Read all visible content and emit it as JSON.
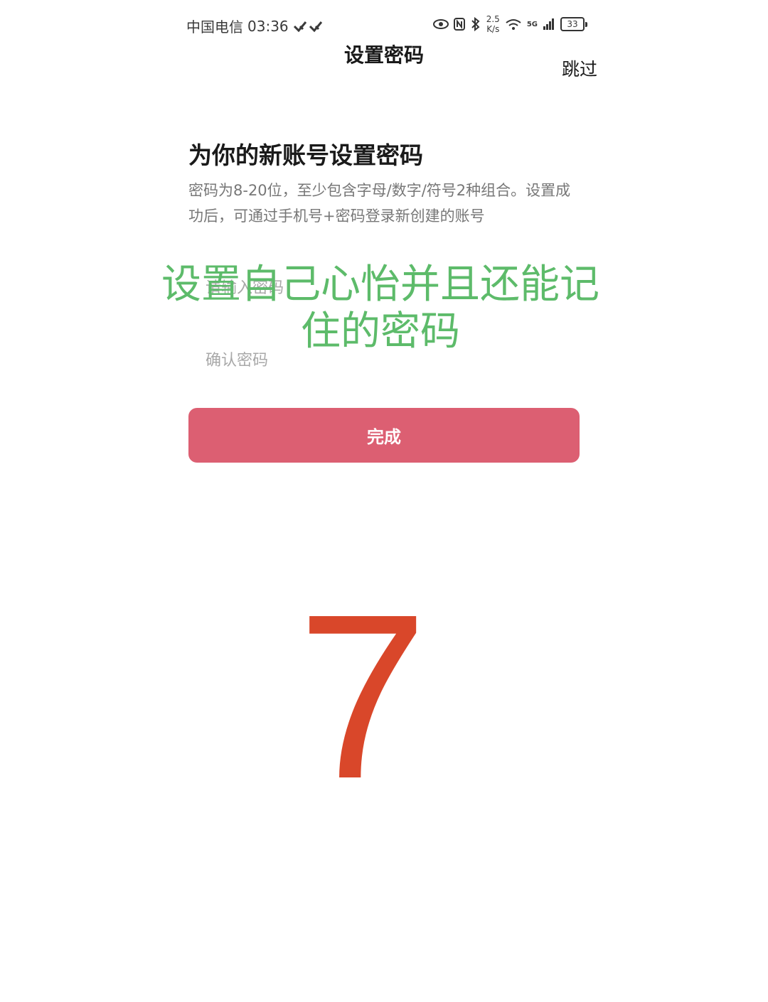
{
  "status_bar": {
    "carrier": "中国电信",
    "time": "03:36",
    "speed_value": "2.5",
    "speed_unit": "K/s",
    "network": "5G",
    "battery": "33"
  },
  "header": {
    "title": "设置密码",
    "skip_label": "跳过"
  },
  "main": {
    "heading": "为你的新账号设置密码",
    "description": "密码为8-20位，至少包含字母/数字/符号2种组合。设置成功后，可通过手机号+密码登录新创建的账号",
    "password_placeholder": "请输入密码",
    "confirm_placeholder": "确认密码",
    "done_label": "完成"
  },
  "overlay": {
    "caption": "设置自己心怡并且还能记住的密码",
    "step_number": "7"
  },
  "colors": {
    "button": "#dc5f72",
    "overlay_text": "#5dbb6a",
    "step_number": "#d9472a"
  }
}
